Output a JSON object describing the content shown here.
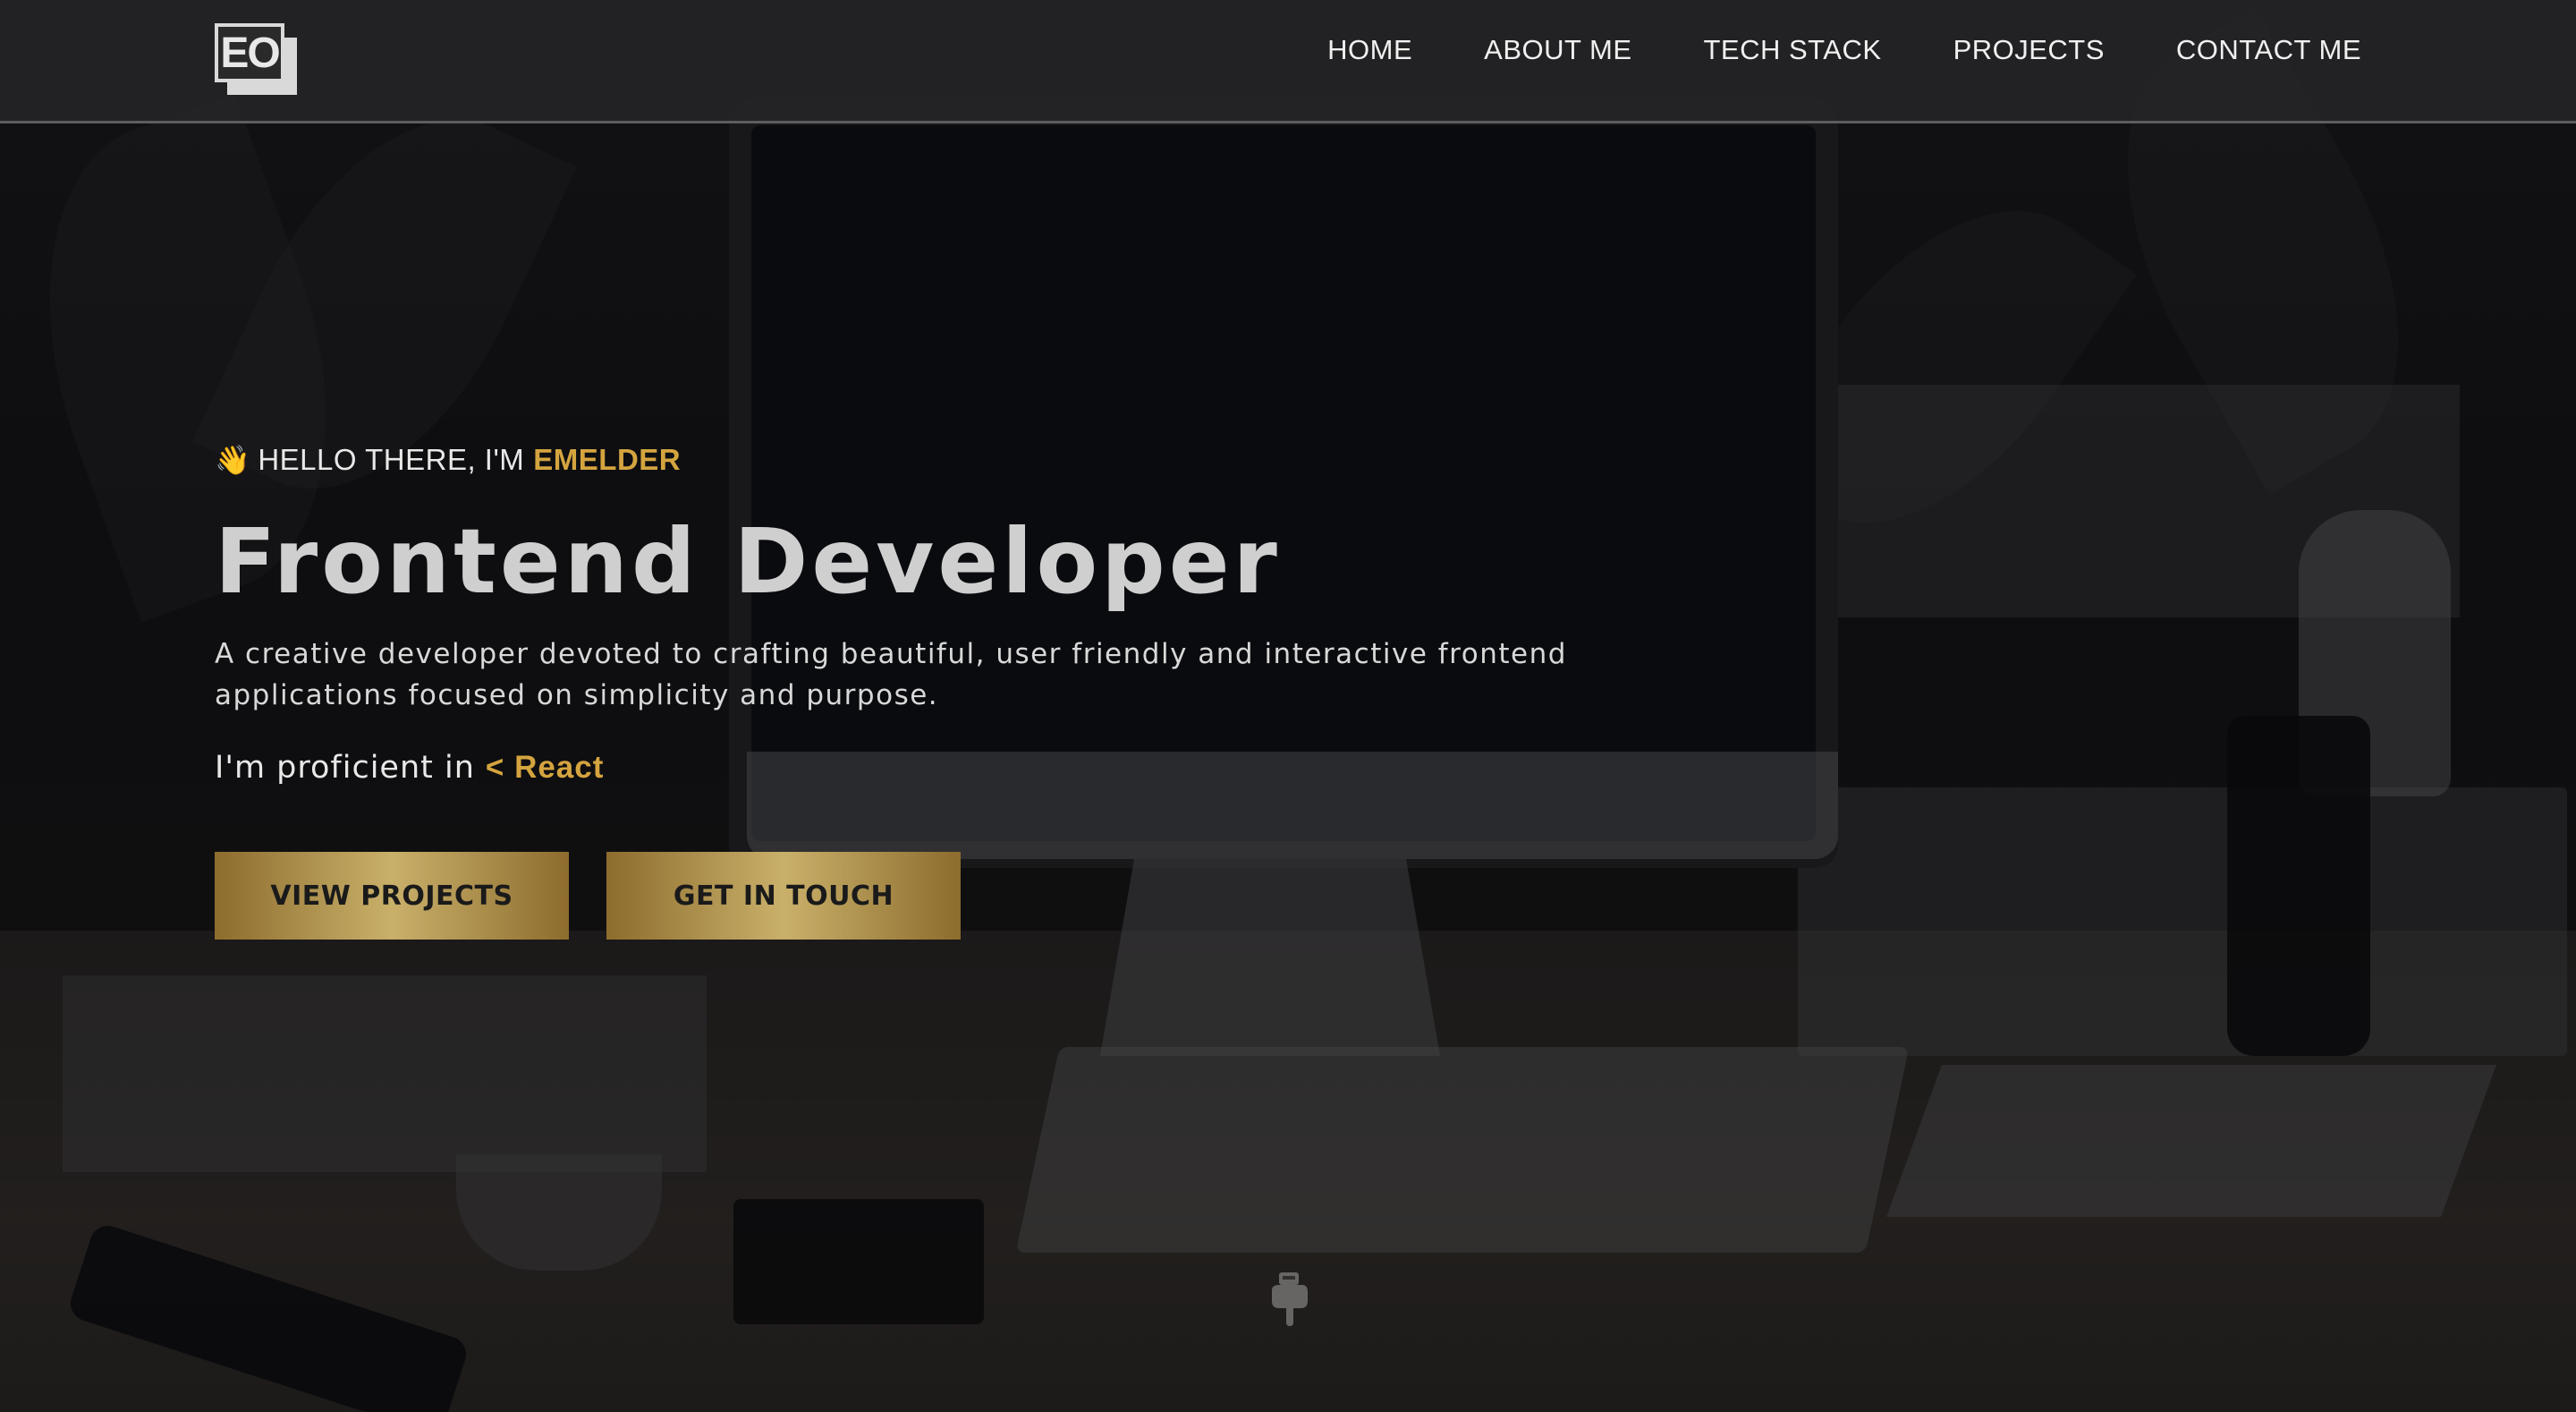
{
  "nav": {
    "logo_text": "EO",
    "links": [
      "HOME",
      "ABOUT ME",
      "TECH STACK",
      "PROJECTS",
      "CONTACT ME"
    ]
  },
  "hero": {
    "greeting_prefix": "HELLO THERE, I'M",
    "greeting_name": "EMELDER",
    "greeting_icon": "waving-hand-icon",
    "title": "Frontend Developer",
    "description": "A creative developer devoted to crafting beautiful, user friendly and interactive frontend applications focused on simplicity and purpose.",
    "proficient_prefix": "I'm proficient in",
    "proficient_tech": "< React",
    "buttons": {
      "view_projects": "VIEW PROJECTS",
      "get_in_touch": "GET IN TOUCH"
    },
    "scroll_icon": "pointing-down-hand-icon"
  },
  "colors": {
    "accent_gold": "#d4a43f",
    "button_gradient_mid": "#c9b06a",
    "navbar_bg": "#262628"
  }
}
